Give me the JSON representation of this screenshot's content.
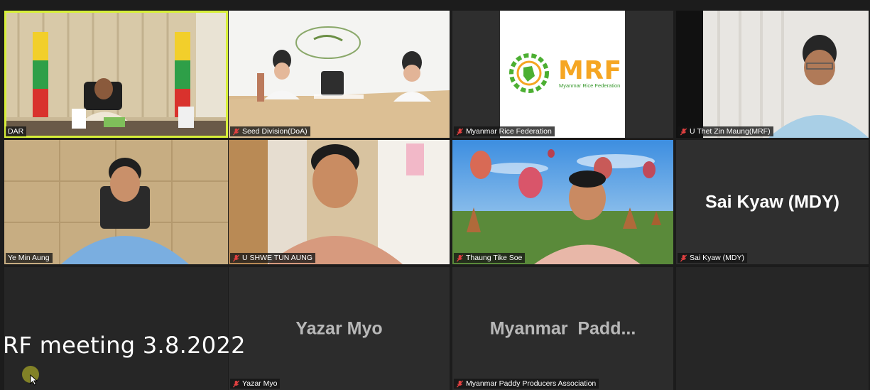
{
  "participants": [
    {
      "name": "DAR",
      "muted": false,
      "active_speaker": true
    },
    {
      "name": "Seed Division(DoA)",
      "muted": true
    },
    {
      "name": "Myanmar Rice Federation",
      "muted": true
    },
    {
      "name": "U Thet Zin Maung(MRF)",
      "muted": true
    },
    {
      "name": "Ye Min Aung",
      "muted": false
    },
    {
      "name": "U SHWE TUN AUNG",
      "muted": true
    },
    {
      "name": "Thaung Tike Soe",
      "muted": true
    },
    {
      "name": "Sai Kyaw (MDY)",
      "muted": true,
      "video_off_label": "Sai Kyaw (MDY)"
    },
    {
      "name": "Yazar Myo",
      "muted": true,
      "video_off_label": "Yazar Myo"
    },
    {
      "name": "Myanmar Paddy Producers Association",
      "muted": true,
      "video_off_label": "Myanmar  Padd..."
    }
  ],
  "logo": {
    "text": "MRF",
    "subtext": "Myanmar Rice Federation",
    "accent": "#f5a623",
    "green": "#4caf32"
  },
  "overlay": {
    "title": "RF meeting 3.8.2022"
  },
  "colors": {
    "active_border": "#d7ef3a",
    "muted_icon": "#e04040",
    "background": "#1c1c1c"
  }
}
